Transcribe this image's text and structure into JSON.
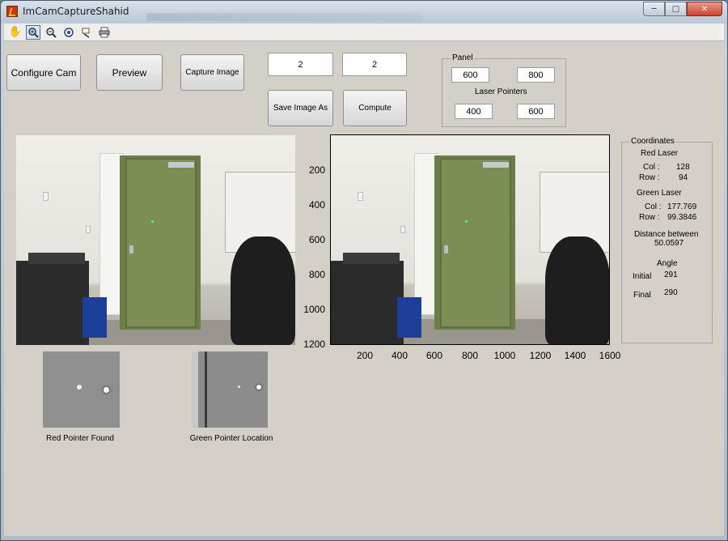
{
  "window": {
    "title": "ImCamCaptureShahid"
  },
  "toolbar": {
    "tools": [
      "hand-pan-icon",
      "zoom-in-icon",
      "zoom-out-icon",
      "rotate-3d-icon",
      "data-cursor-icon",
      "print-icon"
    ]
  },
  "controls": {
    "configure_cam": "Configure Cam",
    "preview": "Preview",
    "capture_image": "Capture Image",
    "save_image_as": "Save Image As",
    "compute": "Compute",
    "edit1_value": "2",
    "edit2_value": "2"
  },
  "panel": {
    "title": "Panel",
    "top_left": "600",
    "top_right": "800",
    "laser_pointers_label": "Laser Pointers",
    "bottom_left": "400",
    "bottom_right": "600"
  },
  "coordinates": {
    "title": "Coordinates",
    "red_laser_label": "Red Laser",
    "red_col_label": "Col :",
    "red_col_value": "128",
    "red_row_label": "Row :",
    "red_row_value": "94",
    "green_laser_label": "Green Laser",
    "green_col_label": "Col :",
    "green_col_value": "177.769",
    "green_row_label": "Row :",
    "green_row_value": "99.3846",
    "distance_label": "Distance between",
    "distance_value": "50.0597",
    "angle_label": "Angle",
    "initial_label": "Initial",
    "initial_value": "291",
    "final_label": "Final",
    "final_value": "290"
  },
  "axes": {
    "y_ticks": [
      "200",
      "400",
      "600",
      "800",
      "1000",
      "1200"
    ],
    "x_ticks": [
      "200",
      "400",
      "600",
      "800",
      "1000",
      "1200",
      "1400",
      "1600"
    ]
  },
  "thumbnails": {
    "red_caption": "Red Pointer Found",
    "green_caption": "Green Pointer Location"
  }
}
